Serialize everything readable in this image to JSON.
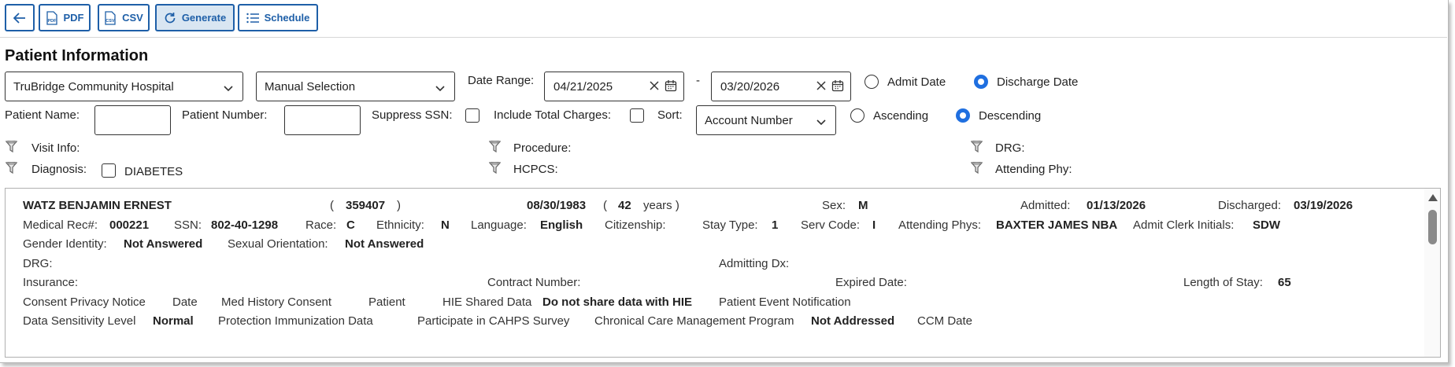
{
  "toolbar": {
    "back_icon": "arrow-left-icon",
    "pdf_label": "PDF",
    "csv_label": "CSV",
    "generate_label": "Generate",
    "schedule_label": "Schedule"
  },
  "section_title": "Patient Information",
  "filters": {
    "facility": "TruBridge Community Hospital",
    "selection_mode": "Manual Selection",
    "date_range_label": "Date Range:",
    "date_from": "04/21/2025",
    "date_separator": "-",
    "date_to": "03/20/2026",
    "admit_date_label": "Admit Date",
    "discharge_date_label": "Discharge Date",
    "date_type_selected": "Discharge Date",
    "patient_name_label": "Patient Name:",
    "patient_name_value": "",
    "patient_number_label": "Patient Number:",
    "patient_number_value": "",
    "suppress_ssn_label": "Suppress SSN:",
    "suppress_ssn_checked": false,
    "include_total_charges_label": "Include Total Charges:",
    "include_total_charges_checked": false,
    "sort_label": "Sort:",
    "sort_value": "Account Number",
    "ascending_label": "Ascending",
    "descending_label": "Descending",
    "sort_order_selected": "Descending",
    "visit_info_label": "Visit Info:",
    "procedure_label": "Procedure:",
    "drg_label": "DRG:",
    "diagnosis_label": "Diagnosis:",
    "diagnosis_option": "DIABETES",
    "diagnosis_option_checked": false,
    "hcpcs_label": "HCPCS:",
    "attending_phy_label": "Attending Phy:"
  },
  "patient": {
    "name": "WATZ BENJAMIN ERNEST",
    "paren_open": "(",
    "paren_close": ")",
    "number": "359407",
    "dob": "08/30/1983",
    "age": "42",
    "age_unit": "years )",
    "sex_label": "Sex:",
    "sex": "M",
    "admitted_label": "Admitted:",
    "admitted": "01/13/2026",
    "discharged_label": "Discharged:",
    "discharged": "03/19/2026",
    "mrn_label": "Medical Rec#:",
    "mrn": "000221",
    "ssn_label": "SSN:",
    "ssn": "802-40-1298",
    "race_label": "Race:",
    "race": "C",
    "ethnicity_label": "Ethnicity:",
    "ethnicity": "N",
    "language_label": "Language:",
    "language": "English",
    "citizenship_label": "Citizenship:",
    "stay_type_label": "Stay Type:",
    "stay_type": "1",
    "serv_code_label": "Serv Code:",
    "serv_code": "I",
    "attending_label": "Attending Phys:",
    "attending": "BAXTER JAMES NBA",
    "admit_clerk_label": "Admit Clerk Initials:",
    "admit_clerk": "SDW",
    "gender_identity_label": "Gender Identity:",
    "gender_identity": "Not Answered",
    "sexual_orientation_label": "Sexual Orientation:",
    "sexual_orientation": "Not Answered",
    "drg_label": "DRG:",
    "admitting_dx_label": "Admitting Dx:",
    "insurance_label": "Insurance:",
    "contract_number_label": "Contract Number:",
    "expired_date_label": "Expired Date:",
    "los_label": "Length of Stay:",
    "los": "65",
    "consent_privacy_label": "Consent Privacy Notice",
    "date_label": "Date",
    "med_history_consent_label": "Med History Consent",
    "patient_label": "Patient",
    "hie_shared_label": "HIE Shared Data",
    "hie_shared": "Do not share data with HIE",
    "patient_event_label": "Patient Event Notification",
    "data_sensitivity_label": "Data Sensitivity Level",
    "data_sensitivity": "Normal",
    "protection_immunization_label": "Protection Immunization Data",
    "cahps_label": "Participate in CAHPS Survey",
    "ccm_program_label": "Chronical Care Management Program",
    "ccm_program": "Not Addressed",
    "ccm_date_label": "CCM Date"
  },
  "colors": {
    "accent": "#1e5fa8",
    "radio_selected": "#1f6fe0",
    "active_button_bg": "#d9e6f2"
  },
  "icons": [
    "arrow-left-icon",
    "pdf-file-icon",
    "csv-file-icon",
    "refresh-icon",
    "list-icon",
    "chevron-down-icon",
    "clear-x-icon",
    "calendar-icon",
    "funnel-icon",
    "scroll-up-arrow-icon"
  ]
}
